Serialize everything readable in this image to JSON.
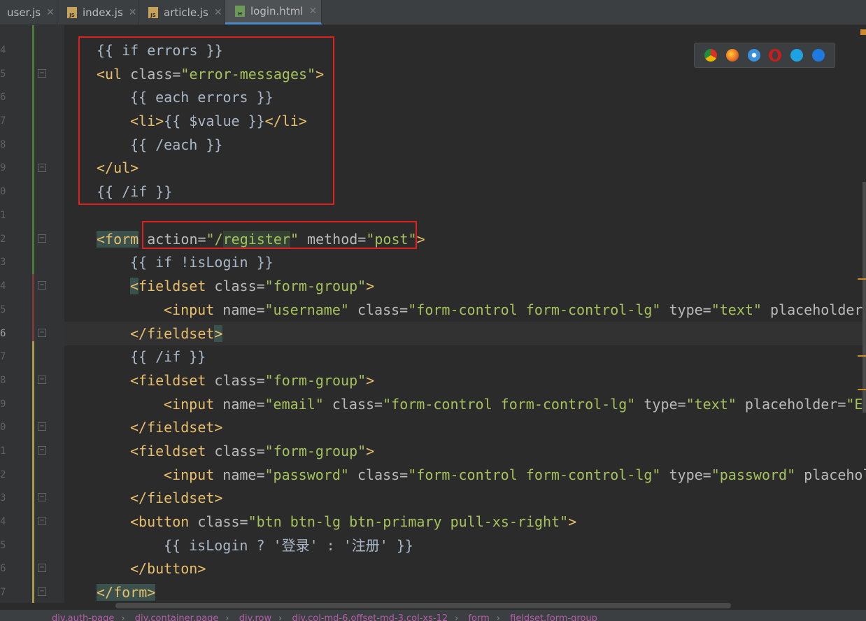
{
  "tabs": [
    {
      "label": "user.js",
      "icon": "js-file-icon",
      "active": false
    },
    {
      "label": "index.js",
      "icon": "js-file-icon",
      "active": false
    },
    {
      "label": "article.js",
      "icon": "js-file-icon",
      "active": false
    },
    {
      "label": "login.html",
      "icon": "html-file-icon",
      "active": true
    }
  ],
  "tab_close_glyph": "✕",
  "line_numbers": [
    "4",
    "5",
    "6",
    "7",
    "8",
    "9",
    "0",
    "1",
    "2",
    "3",
    "4",
    "5",
    "6",
    "7",
    "8",
    "9",
    "0",
    "1",
    "2",
    "3",
    "4",
    "5",
    "6",
    "7"
  ],
  "code": {
    "l1": "{{ if errors }}",
    "l2a": "<ul",
    "l2b": " class=",
    "l2c": "\"error-messages\"",
    "l2d": ">",
    "l3": "{{ each errors }}",
    "l4a": "<li>",
    "l4b": "{{ $value }}",
    "l4c": "</li>",
    "l5": "{{ /each }}",
    "l6": "</ul>",
    "l7": "{{ /if }}",
    "l9a": "<form",
    "l9b": " action=",
    "l9c": "\"/",
    "l9d": "register",
    "l9e": "\"",
    "l9f": " method=",
    "l9g": "\"post\"",
    "l9h": ">",
    "l10": "{{ if !isLogin }}",
    "l11a": "<",
    "l11b": "fieldset",
    "l11c": " class=",
    "l11d": "\"form-group\"",
    "l11e": ">",
    "l12a": "<",
    "l12b": "input",
    "l12c": " name=",
    "l12d": "\"username\"",
    "l12e": " class=",
    "l12f": "\"form-control form-control-lg\"",
    "l12g": " type=",
    "l12h": "\"text\"",
    "l12i": " placeholder=",
    "l13a": "</fieldset",
    "l13b": ">",
    "l14": "{{ /if }}",
    "l15a": "<fieldset",
    "l15b": " class=",
    "l15c": "\"form-group\"",
    "l15d": ">",
    "l16a": "<",
    "l16b": "input",
    "l16c": " name=",
    "l16d": "\"email\"",
    "l16e": " class=",
    "l16f": "\"form-control form-control-lg\"",
    "l16g": " type=",
    "l16h": "\"text\"",
    "l16i": " placeholder=",
    "l16j": "\"Em",
    "l17": "</fieldset>",
    "l18a": "<fieldset",
    "l18b": " class=",
    "l18c": "\"form-group\"",
    "l18d": ">",
    "l19a": "<",
    "l19b": "input",
    "l19c": " name=",
    "l19d": "\"password\"",
    "l19e": " class=",
    "l19f": "\"form-control form-control-lg\"",
    "l19g": " type=",
    "l19h": "\"password\"",
    "l19i": " placehol",
    "l20": "</fieldset>",
    "l21a": "<button",
    "l21b": " class=",
    "l21c": "\"btn btn-lg btn-primary pull-xs-right\"",
    "l21d": ">",
    "l22": "{{ isLogin ? '登录' : '注册' }}",
    "l23": "</button>",
    "l24": "</form>"
  },
  "browser_icons": [
    "chrome-icon",
    "firefox-icon",
    "safari-icon",
    "opera-icon",
    "ie-icon",
    "edge-icon"
  ],
  "colors": {
    "chrome": "#e0a829",
    "firefox": "#e66a1f",
    "safari": "#3a8fd9",
    "opera": "#cc1b1b",
    "ie": "#1fa3e0",
    "edge": "#1f7ae0"
  },
  "breadcrumb": [
    "div.auth-page",
    "div.container.page",
    "div.row",
    "div.col-md-6.offset-md-3.col-xs-12",
    "form",
    "fieldset.form-group"
  ],
  "breadcrumb_sep": "›"
}
